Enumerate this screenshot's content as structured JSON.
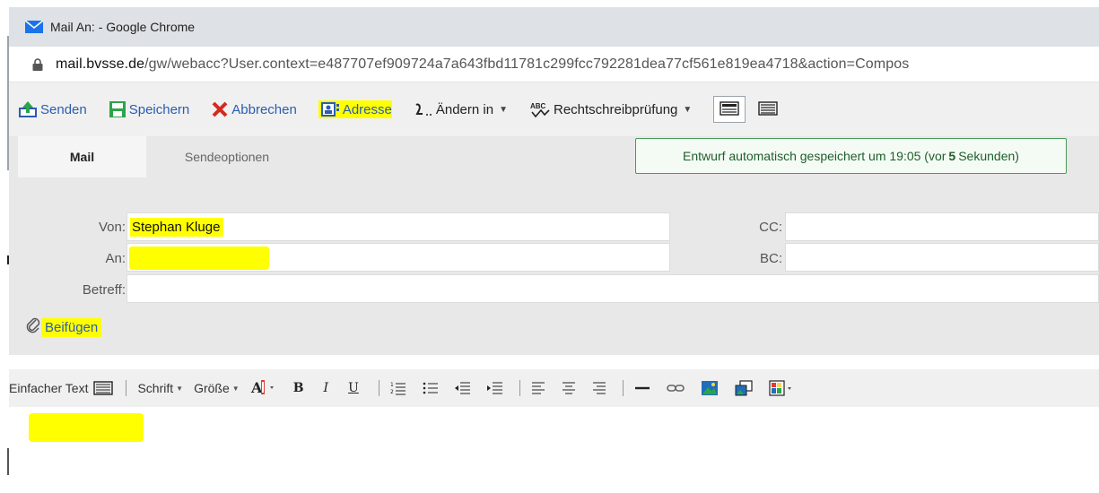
{
  "window": {
    "title": "Mail An: - Google Chrome"
  },
  "urlbar": {
    "domain": "mail.bvsse.de",
    "path": "/gw/webacc?User.context=e487707ef909724a7a643fbd11781c299fcc792281dea77cf561e819ea4718&action=Compos"
  },
  "toolbar": {
    "send_label": "Senden",
    "save_label": "Speichern",
    "cancel_label": "Abbrechen",
    "address_label": "Adresse",
    "change_label": "Ändern in",
    "spell_label": "Rechtschreibprüfung",
    "spell_icon_text": "ABC"
  },
  "tabs": [
    {
      "label": "Mail",
      "active": true
    },
    {
      "label": "Sendeoptionen",
      "active": false
    }
  ],
  "autosave": {
    "prefix": "Entwurf automatisch gespeichert um 19:05 (vor",
    "seconds": "5",
    "suffix": "Sekunden)"
  },
  "fields": {
    "from_label": "Von:",
    "from_value": "Stephan Kluge",
    "to_label": "An:",
    "to_value": "",
    "subject_label": "Betreff:",
    "subject_value": "",
    "cc_label": "CC:",
    "cc_value": "",
    "bc_label": "BC:",
    "bc_value": ""
  },
  "attach": {
    "label": "Beifügen"
  },
  "editor_toolbar": {
    "plain_text_label": "Einfacher Text",
    "font_label": "Schrift",
    "size_label": "Größe",
    "bold": "B",
    "italic": "I",
    "underline": "U"
  },
  "colors": {
    "highlight": "#ffff00",
    "link_blue": "#2a5db0",
    "autosave_border": "#4a9a5a",
    "cancel_red": "#d42a1e"
  }
}
